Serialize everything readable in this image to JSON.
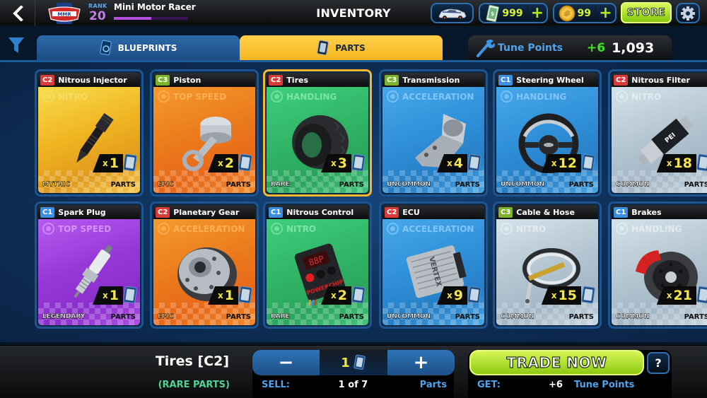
{
  "header": {
    "back_label": "Back",
    "logo_text": "MMR",
    "rank_label": "RANK",
    "rank_value": "20",
    "player_name": "Mini Motor Racer",
    "xp_progress": 0.5,
    "title": "INVENTORY",
    "cash_value": "999",
    "coin_value": "99",
    "store_label": "STORE",
    "icons": [
      "back-arrow-icon",
      "car-icon",
      "cash-icon",
      "coin-icon",
      "plus-icon",
      "gear-icon"
    ]
  },
  "tabs": {
    "filter_icon": "filter-icon",
    "items": [
      {
        "label": "BLUEPRINTS",
        "active": false
      },
      {
        "label": "PARTS",
        "active": true
      }
    ]
  },
  "tune_points": {
    "label": "Tune Points",
    "gain": "+6",
    "total": "1,093"
  },
  "colors": {
    "class_C1": "#3b8ee0",
    "class_C2": "#d93a3a",
    "class_C3": "#7cb32a",
    "mythic": "#f4c22c",
    "epic": "#f08a22",
    "rare": "#3dbb6d",
    "uncommon": "#3d9fe0",
    "common": "#b9cad6",
    "legendary": "#a84ce0",
    "accent_green": "#9ad61a",
    "selection": "#f3b92a"
  },
  "parts": [
    {
      "class": "C2",
      "name": "Nitrous Injector",
      "stat": "NITRO",
      "qty": "1",
      "rarity": "MYTHIC",
      "footer": "PARTS",
      "art": "nitrous-injector"
    },
    {
      "class": "C3",
      "name": "Piston",
      "stat": "TOP SPEED",
      "qty": "2",
      "rarity": "EPIC",
      "footer": "PARTS",
      "art": "piston"
    },
    {
      "class": "C2",
      "name": "Tires",
      "stat": "HANDLING",
      "qty": "3",
      "rarity": "RARE",
      "footer": "PARTS",
      "art": "tire",
      "selected": true
    },
    {
      "class": "C3",
      "name": "Transmission",
      "stat": "ACCELERATION",
      "qty": "4",
      "rarity": "UNCOMMON",
      "footer": "PARTS",
      "art": "transmission"
    },
    {
      "class": "C1",
      "name": "Steering Wheel",
      "stat": "HANDLING",
      "qty": "12",
      "rarity": "UNCOMMON",
      "footer": "PARTS",
      "art": "steering-wheel"
    },
    {
      "class": "C2",
      "name": "Nitrous Filter",
      "stat": "NITRO",
      "qty": "18",
      "rarity": "COMMON",
      "footer": "PARTS",
      "art": "nitrous-filter"
    },
    {
      "class": "C1",
      "name": "Spark Plug",
      "stat": "TOP SPEED",
      "qty": "1",
      "rarity": "LEGENDARY",
      "footer": "PARTS",
      "art": "spark-plug"
    },
    {
      "class": "C2",
      "name": "Planetary Gear",
      "stat": "ACCELERATION",
      "qty": "1",
      "rarity": "EPIC",
      "footer": "PARTS",
      "art": "planetary-gear"
    },
    {
      "class": "C1",
      "name": "Nitrous Control",
      "stat": "NITRO",
      "qty": "2",
      "rarity": "RARE",
      "footer": "PARTS",
      "art": "nitrous-control"
    },
    {
      "class": "C2",
      "name": "ECU",
      "stat": "ACCELERATION",
      "qty": "9",
      "rarity": "UNCOMMON",
      "footer": "PARTS",
      "art": "ecu"
    },
    {
      "class": "C3",
      "name": "Cable & Hose",
      "stat": "NITRO",
      "qty": "15",
      "rarity": "COMMON",
      "footer": "PARTS",
      "art": "cable-hose"
    },
    {
      "class": "C1",
      "name": "Brakes",
      "stat": "HANDLING",
      "qty": "21",
      "rarity": "COMMON",
      "footer": "PARTS",
      "art": "brakes"
    }
  ],
  "selection": {
    "name": "Tires [C2]",
    "rarity_label": "(RARE PARTS)",
    "minus_label": "−",
    "plus_label": "+",
    "amount": "1",
    "sell_label": "SELL:",
    "sell_count": "1 of 7",
    "sell_unit": "Parts",
    "trade_label": "TRADE NOW",
    "help_label": "?",
    "get_label": "GET:",
    "get_amount": "+6",
    "get_unit": "Tune Points"
  }
}
